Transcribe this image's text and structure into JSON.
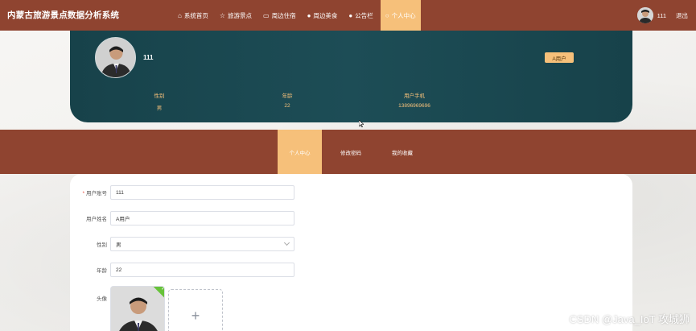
{
  "app": {
    "title": "内蒙古旅游景点数据分析系统"
  },
  "nav": [
    {
      "label": "系统首页",
      "icon": "home-icon"
    },
    {
      "label": "旅游景点",
      "icon": "star-icon"
    },
    {
      "label": "周边住宿",
      "icon": "bag-icon"
    },
    {
      "label": "周边美食",
      "icon": "info-icon"
    },
    {
      "label": "公告栏",
      "icon": "info-icon"
    },
    {
      "label": "个人中心",
      "icon": "chat-icon",
      "active": true
    }
  ],
  "user": {
    "name": "111",
    "logout": "退出"
  },
  "profile": {
    "name": "111",
    "role": "A用户",
    "stats": [
      {
        "label": "性别",
        "value": "男"
      },
      {
        "label": "年龄",
        "value": "22"
      },
      {
        "label": "用户手机",
        "value": "13896969696"
      }
    ]
  },
  "tabs": [
    {
      "label": "个人中心",
      "active": true
    },
    {
      "label": "修改密码"
    },
    {
      "label": "我的收藏"
    }
  ],
  "form": {
    "fields": [
      {
        "label": "用户账号",
        "value": "111",
        "required": true
      },
      {
        "label": "用户姓名",
        "value": "A用户"
      },
      {
        "label": "性别",
        "value": "男",
        "type": "select"
      },
      {
        "label": "年龄",
        "value": "22"
      }
    ],
    "avatar_label": "头像",
    "upload_plus": "+"
  },
  "watermark": "CSDN @Java_IoT 攻城狮",
  "colors": {
    "primary": "#8f4430",
    "accent": "#f6c07a",
    "card": "#1d4d56"
  }
}
